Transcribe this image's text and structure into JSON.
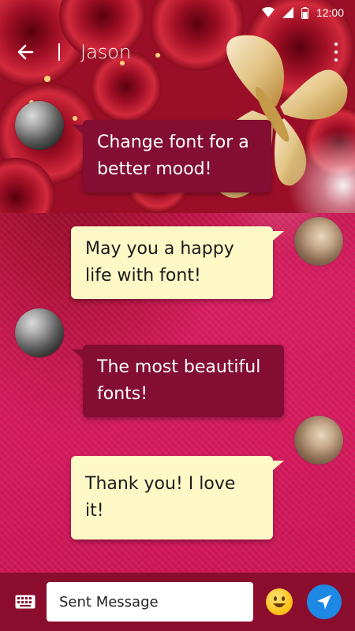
{
  "status_bar": {
    "time": "12:00"
  },
  "header": {
    "title": "Jason"
  },
  "messages": [
    {
      "side": "incoming",
      "line1": "Change font for a",
      "line2": "better mood!"
    },
    {
      "side": "outgoing",
      "line1": "May you a happy",
      "line2": "life with font!"
    },
    {
      "side": "incoming",
      "line1": "The most beautiful",
      "line2": "fonts!"
    },
    {
      "side": "outgoing",
      "line1": "Thank you! I love it!"
    }
  ],
  "composer": {
    "placeholder": "Sent Message"
  },
  "icons": {
    "back": "arrow-left-icon",
    "menu": "more-vert-icon",
    "keyboard": "keyboard-icon",
    "emoji": "smiley-emoji-icon",
    "send": "send-icon"
  },
  "colors": {
    "incoming_bubble": "#830d33",
    "outgoing_bubble": "#fff9c7",
    "input_bar": "#8a0d2e",
    "send_button": "#1e88e5"
  }
}
